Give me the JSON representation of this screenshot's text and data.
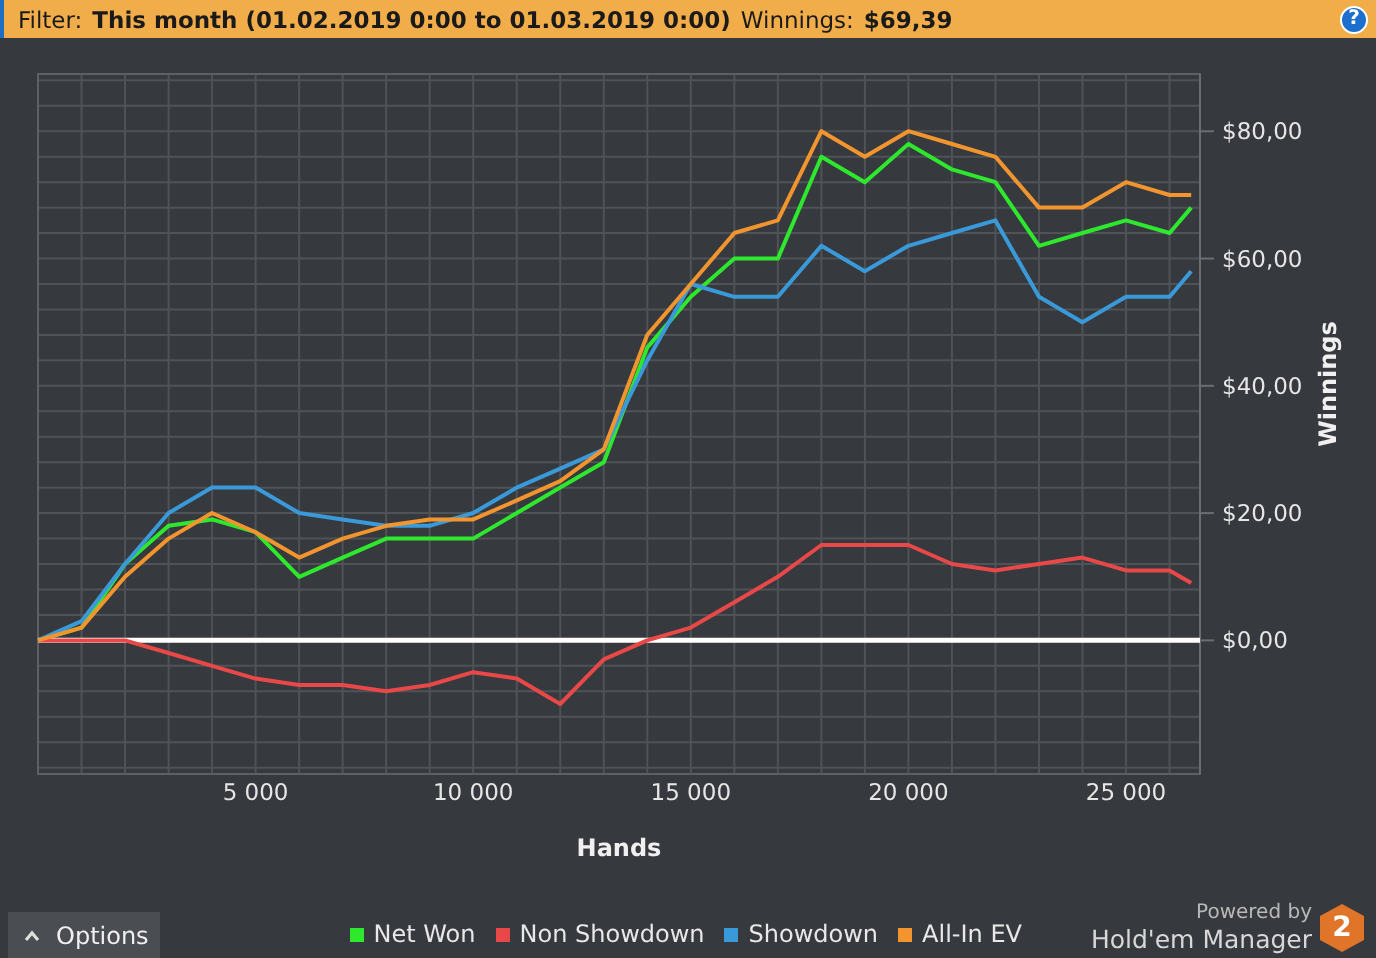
{
  "filter_bar": {
    "filter_label": "Filter:",
    "filter_value": "This month (01.02.2019 0:00 to 01.03.2019 0:00)",
    "winnings_label": "Winnings:",
    "winnings_value": "$69,39",
    "help_button": "?"
  },
  "chart": {
    "chart_data": {
      "type": "line",
      "grid": true,
      "xlabel": "Hands",
      "ylabel": "Winnings",
      "xlim": [
        0,
        26700
      ],
      "ylim": [
        -21,
        89
      ],
      "xticks": [
        {
          "value": 5000,
          "label": "5 000"
        },
        {
          "value": 10000,
          "label": "10 000"
        },
        {
          "value": 15000,
          "label": "15 000"
        },
        {
          "value": 20000,
          "label": "20 000"
        },
        {
          "value": 25000,
          "label": "25 000"
        }
      ],
      "yticks": [
        {
          "value": 0,
          "label": "$0,00"
        },
        {
          "value": 20,
          "label": "$20,00"
        },
        {
          "value": 40,
          "label": "$40,00"
        },
        {
          "value": 60,
          "label": "$60,00"
        },
        {
          "value": 80,
          "label": "$80,00"
        }
      ],
      "x": [
        0,
        1000,
        2000,
        3000,
        4000,
        5000,
        6000,
        7000,
        8000,
        9000,
        10000,
        11000,
        12000,
        13000,
        14000,
        15000,
        16000,
        17000,
        18000,
        19000,
        20000,
        21000,
        22000,
        23000,
        24000,
        25000,
        26000,
        26500
      ],
      "series": [
        {
          "name": "Net Won",
          "color": "#2ee82e",
          "values": [
            0,
            2,
            12,
            18,
            19,
            17,
            10,
            13,
            16,
            16,
            16,
            20,
            24,
            28,
            46,
            54,
            60,
            60,
            76,
            72,
            78,
            74,
            72,
            62,
            64,
            66,
            64,
            68
          ]
        },
        {
          "name": "Non Showdown",
          "color": "#e84848",
          "values": [
            0,
            0,
            0,
            -2,
            -4,
            -6,
            -7,
            -7,
            -8,
            -7,
            -5,
            -6,
            -10,
            -3,
            0,
            2,
            6,
            10,
            15,
            15,
            15,
            12,
            11,
            12,
            13,
            11,
            11,
            9
          ]
        },
        {
          "name": "Showdown",
          "color": "#3a9ad9",
          "values": [
            0,
            3,
            12,
            20,
            24,
            24,
            20,
            19,
            18,
            18,
            20,
            24,
            27,
            30,
            44,
            56,
            54,
            54,
            62,
            58,
            62,
            64,
            66,
            54,
            50,
            54,
            54,
            58
          ]
        },
        {
          "name": "All-In EV",
          "color": "#f3952f",
          "values": [
            0,
            2,
            10,
            16,
            20,
            17,
            13,
            16,
            18,
            19,
            19,
            22,
            25,
            30,
            48,
            56,
            64,
            66,
            80,
            76,
            80,
            78,
            76,
            68,
            68,
            72,
            70,
            70
          ]
        }
      ]
    }
  },
  "footer": {
    "options_button": "Options",
    "powered_by": "Powered by",
    "brand": "Hold'em Manager",
    "brand_mark": "2"
  }
}
